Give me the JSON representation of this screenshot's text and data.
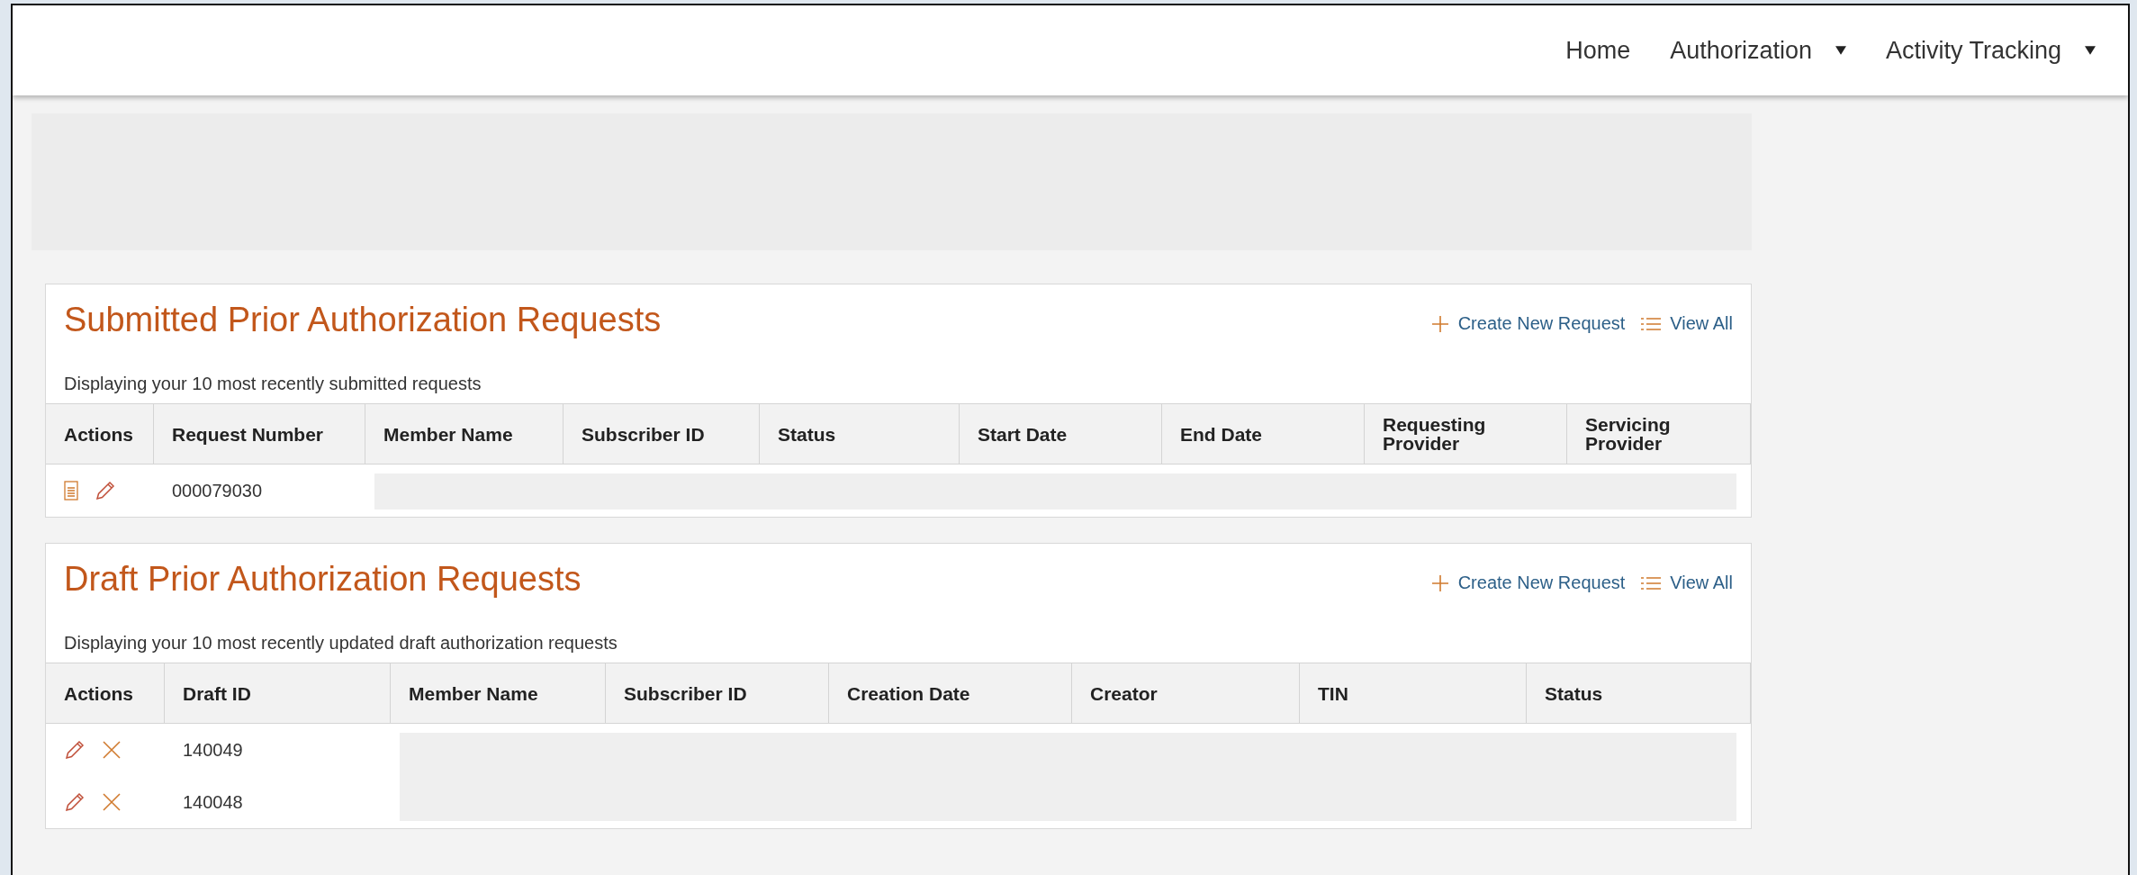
{
  "nav": {
    "items": [
      {
        "label": "Home",
        "dropdown": false
      },
      {
        "label": "Authorization",
        "dropdown": true
      },
      {
        "label": "Activity Tracking",
        "dropdown": true
      }
    ]
  },
  "panels": [
    {
      "kind": "submitted",
      "title": "Submitted Prior Authorization Requests",
      "links": [
        {
          "kind": "create",
          "label": "Create New Request"
        },
        {
          "kind": "view",
          "label": "View All"
        }
      ],
      "subtitle": "Displaying your 10 most recently submitted requests",
      "columns": [
        "Actions",
        "Request Number",
        "Member Name",
        "Subscriber ID",
        "Status",
        "Start Date",
        "End Date",
        "Requesting Provider",
        "Servicing Provider"
      ],
      "rows": [
        {
          "id": "000079030",
          "actions": [
            {
              "kind": "view"
            },
            {
              "kind": "edit"
            }
          ]
        }
      ]
    },
    {
      "kind": "draft",
      "title": "Draft Prior Authorization Requests",
      "links": [
        {
          "kind": "create",
          "label": "Create New Request"
        },
        {
          "kind": "view",
          "label": "View All"
        }
      ],
      "subtitle": "Displaying your 10 most recently updated draft authorization requests",
      "columns": [
        "Actions",
        "Draft ID",
        "Member Name",
        "Subscriber ID",
        "Creation Date",
        "Creator",
        "TIN",
        "Status"
      ],
      "rows": [
        {
          "id": "140049",
          "actions": [
            {
              "kind": "edit"
            },
            {
              "kind": "delete"
            }
          ]
        },
        {
          "id": "140048",
          "actions": [
            {
              "kind": "edit"
            },
            {
              "kind": "delete"
            }
          ]
        }
      ]
    }
  ]
}
